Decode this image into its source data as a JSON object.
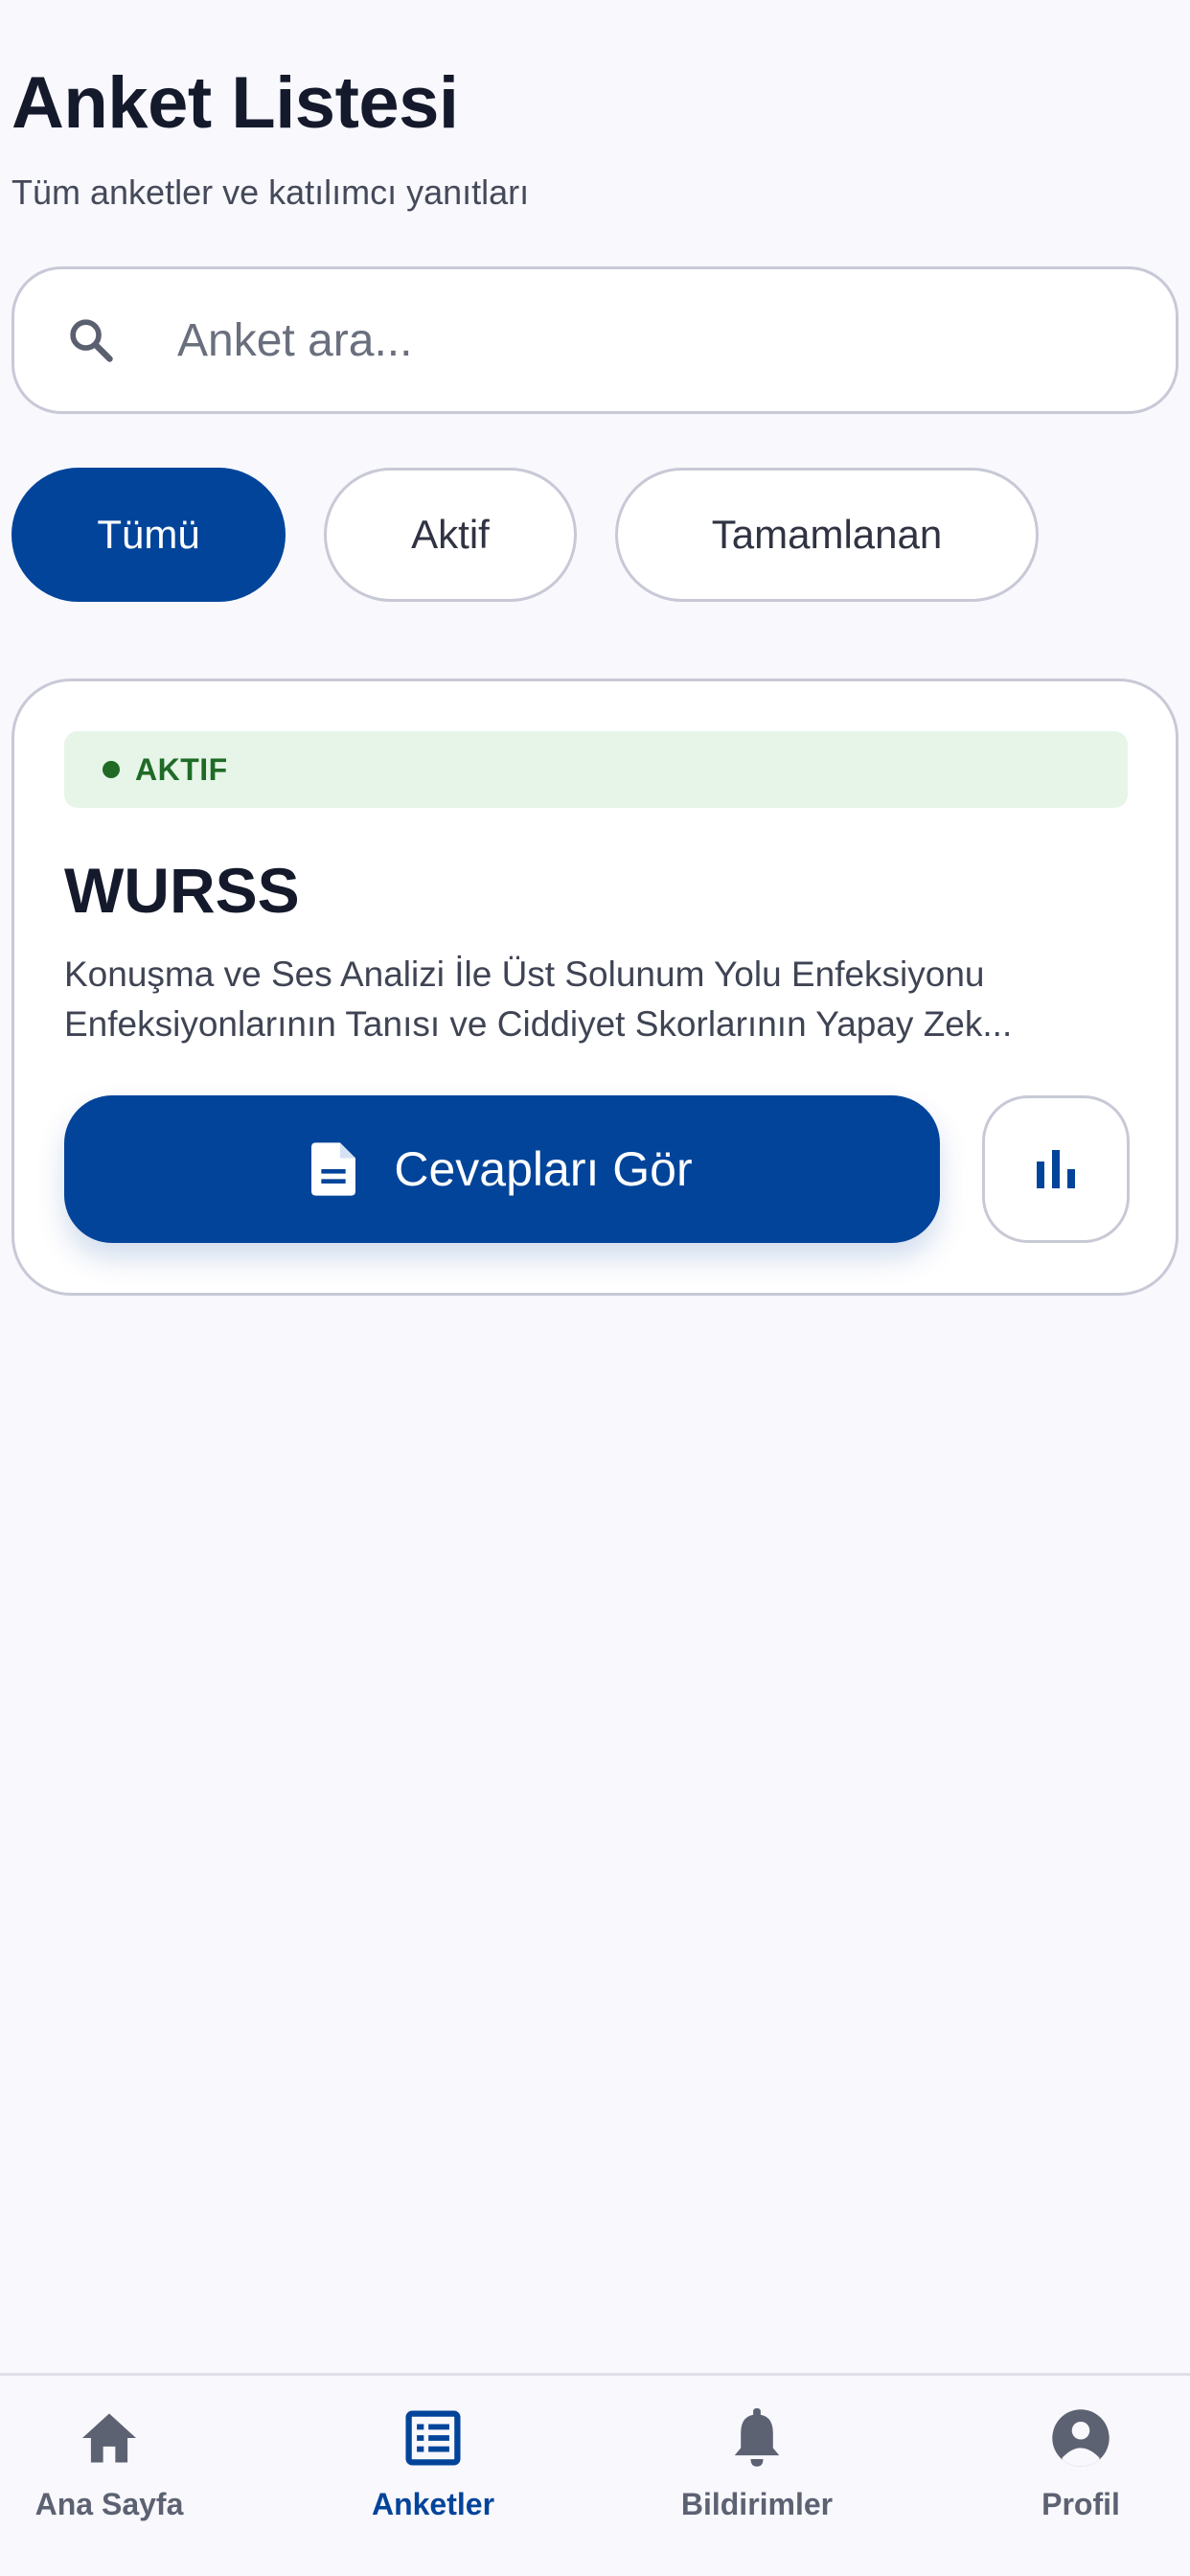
{
  "header": {
    "title": "Anket Listesi",
    "subtitle": "Tüm anketler ve katılımcı yanıtları"
  },
  "search": {
    "placeholder": "Anket ara...",
    "value": "",
    "icon": "search-icon"
  },
  "filters": [
    {
      "label": "Tümü",
      "selected": true
    },
    {
      "label": "Aktif",
      "selected": false
    },
    {
      "label": "Tamamlanan",
      "selected": false
    }
  ],
  "survey_card": {
    "status": "AKTIF",
    "title": "WURSS",
    "description": "Konuşma ve Ses Analizi İle Üst Solunum Yolu Enfeksiyonu Enfeksiyonlarının Tanısı ve Ciddiyet Skorlarının Yapay Zek...",
    "primary_action": "Cevapları Gör",
    "primary_icon": "document-icon",
    "secondary_icon": "bar-chart-icon"
  },
  "bottom_nav": [
    {
      "label": "Ana Sayfa",
      "icon": "home-icon",
      "active": false
    },
    {
      "label": "Anketler",
      "icon": "list-icon",
      "active": true
    },
    {
      "label": "Bildirimler",
      "icon": "bell-icon",
      "active": false
    },
    {
      "label": "Profil",
      "icon": "profile-icon",
      "active": false
    }
  ],
  "colors": {
    "primary": "#02449a",
    "background": "#f8f8fd",
    "status_green": "#1f6b26",
    "status_bg": "#e6f5e8",
    "nav_inactive": "#5d6272"
  }
}
